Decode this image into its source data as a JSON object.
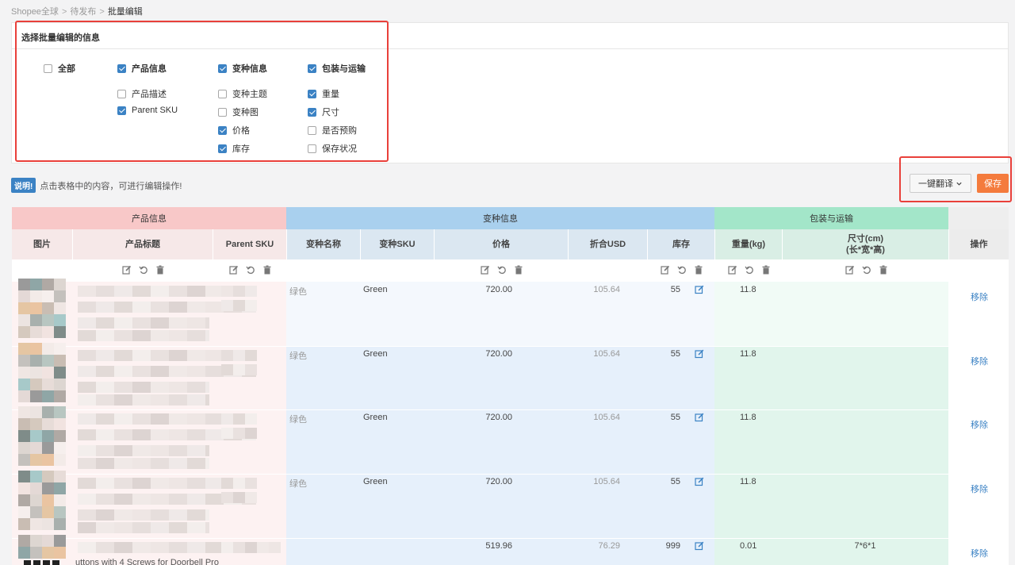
{
  "breadcrumb": {
    "items": [
      "Shopee全球",
      "待发布",
      "批量编辑"
    ],
    "separator": ">"
  },
  "panel": {
    "title": "选择批量编辑的信息",
    "options": [
      {
        "label": "全部",
        "checked": false,
        "bold": true
      },
      {
        "label": "产品信息",
        "checked": true,
        "bold": true
      },
      {
        "label": "变种信息",
        "checked": true,
        "bold": true
      },
      {
        "label": "包装与运输",
        "checked": true,
        "bold": true
      },
      {
        "label": "产品描述",
        "checked": false
      },
      {
        "label": "Parent SKU",
        "checked": true
      },
      {
        "label": "变种主题",
        "checked": false
      },
      {
        "label": "变种图",
        "checked": false
      },
      {
        "label": "价格",
        "checked": true
      },
      {
        "label": "库存",
        "checked": true
      },
      {
        "label": "重量",
        "checked": true
      },
      {
        "label": "尺寸",
        "checked": true
      },
      {
        "label": "是否预购",
        "checked": false
      },
      {
        "label": "保存状况",
        "checked": false
      }
    ]
  },
  "note": {
    "tag": "说明!",
    "text": "点击表格中的内容，可进行编辑操作!"
  },
  "actions": {
    "translate": "一键翻译",
    "save": "保存"
  },
  "colors": {
    "accent": "#3b82c4",
    "save": "#f47b3d",
    "highlight": "#e9403a",
    "product_header": "#f8c8c8",
    "variant_header": "#a9d0ee",
    "shipping_header": "#a3e6c9"
  },
  "table": {
    "groups": [
      "产品信息",
      "变种信息",
      "包装与运输"
    ],
    "columns": [
      "图片",
      "产品标题",
      "Parent SKU",
      "变种名称",
      "变种SKU",
      "价格",
      "折合USD",
      "库存",
      "重量(kg)",
      "尺寸(cm)",
      "(长*宽*高)",
      "操作"
    ],
    "rows": [
      {
        "variant_name": "绿色",
        "variant_sku": "Green",
        "price": "720.00",
        "usd": "105.64",
        "stock": "55",
        "weight": "11.8",
        "size": "",
        "action": "移除"
      },
      {
        "variant_name": "绿色",
        "variant_sku": "Green",
        "price": "720.00",
        "usd": "105.64",
        "stock": "55",
        "weight": "11.8",
        "size": "",
        "action": "移除"
      },
      {
        "variant_name": "绿色",
        "variant_sku": "Green",
        "price": "720.00",
        "usd": "105.64",
        "stock": "55",
        "weight": "11.8",
        "size": "",
        "action": "移除"
      },
      {
        "variant_name": "绿色",
        "variant_sku": "Green",
        "price": "720.00",
        "usd": "105.64",
        "stock": "55",
        "weight": "11.8",
        "size": "",
        "action": "移除"
      },
      {
        "variant_name": "",
        "variant_sku": "",
        "price": "519.96",
        "usd": "76.29",
        "stock": "999",
        "weight": "0.01",
        "size": "7*6*1",
        "action": "移除"
      }
    ],
    "partial_title": "uttons with 4 Screws for Doorbell Pro"
  }
}
